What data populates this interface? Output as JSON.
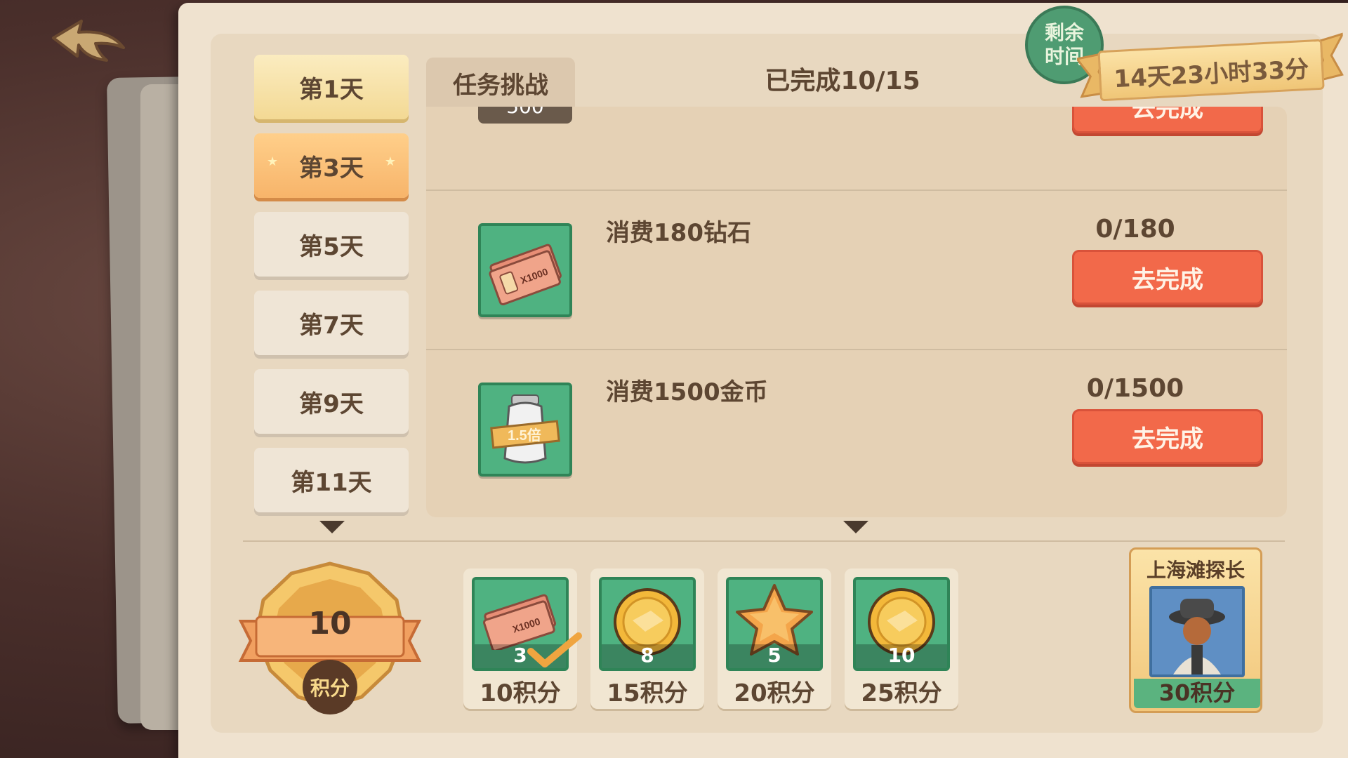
{
  "tabs": {
    "task_challenge": "任务挑战",
    "completed": "已完成10/15"
  },
  "timer": {
    "badge": [
      "剩余",
      "时间"
    ],
    "remaining": "14天23小时33分"
  },
  "days": [
    {
      "label": "第1天"
    },
    {
      "label": "第3天"
    },
    {
      "label": "第5天"
    },
    {
      "label": "第7天"
    },
    {
      "label": "第9天"
    },
    {
      "label": "第11天"
    }
  ],
  "tasks": [
    {
      "title": "消费180钻石",
      "progress": "0/180",
      "button": "去完成",
      "icon": "diamond-ticket-icon"
    },
    {
      "title": "消费1500金币",
      "progress": "0/1500",
      "button": "去完成",
      "icon": "milk-1.5x-icon"
    }
  ],
  "partial_top": {
    "reward": "500",
    "button": "去完成"
  },
  "score": {
    "value": "10",
    "label": "积分"
  },
  "rewards": [
    {
      "count": "3",
      "points": "10积分",
      "icon": "ticket-x1000-icon",
      "claimed": true
    },
    {
      "count": "8",
      "points": "15积分",
      "icon": "gold-coin-icon",
      "claimed": false
    },
    {
      "count": "5",
      "points": "20积分",
      "icon": "star-icon",
      "claimed": false
    },
    {
      "count": "10",
      "points": "25积分",
      "icon": "gold-coin-icon",
      "claimed": false
    }
  ],
  "final_reward": {
    "title": "上海滩探长",
    "points": "30积分"
  },
  "labels": {
    "ticket_x": "X1000",
    "milk_multi": "1.5倍"
  },
  "colors": {
    "go_button": "#f2694a",
    "tile_green": "#4fb281",
    "panel": "#efe2cf"
  }
}
